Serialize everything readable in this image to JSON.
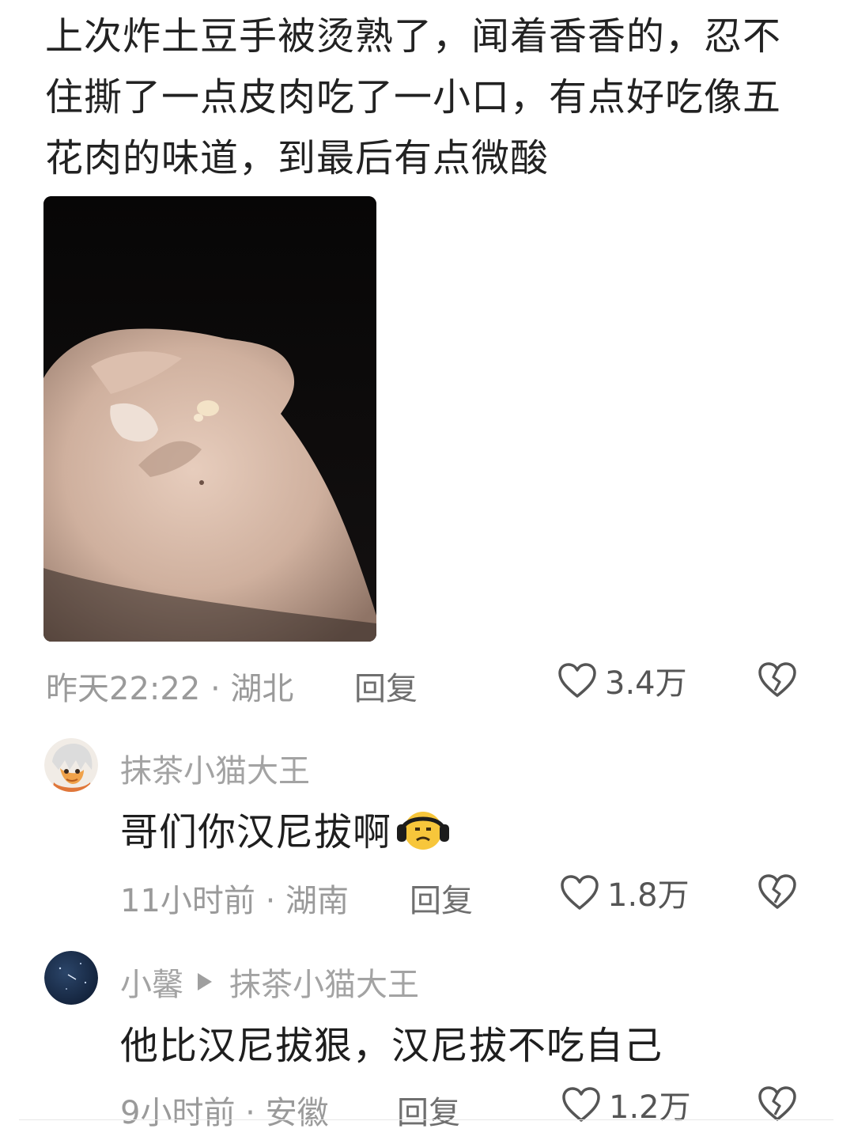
{
  "post": {
    "text": "上次炸土豆手被烫熟了，闻着香香的，忍不住撕了一点皮肉吃了一小口，有点好吃像五花肉的味道，到最后有点微酸",
    "meta": {
      "time_location": "昨天22:22 · 湖北",
      "reply_label": "回复",
      "like_count": "3.4万"
    }
  },
  "comments": [
    {
      "username": "抹茶小猫大王",
      "text": "哥们你汉尼拔啊",
      "emoji": "sad-headphones-emoji",
      "time_location": "11小时前 · 湖南",
      "reply_label": "回复",
      "like_count": "1.8万"
    },
    {
      "username": "小馨",
      "reply_to": "抹茶小猫大王",
      "text": "他比汉尼拔狠，汉尼拔不吃自己",
      "time_location": "9小时前 · 安徽",
      "reply_label": "回复",
      "like_count": "1.2万"
    }
  ],
  "colors": {
    "text": "#222222",
    "meta": "#9a9a9a",
    "icon": "#555555",
    "background": "#ffffff"
  }
}
